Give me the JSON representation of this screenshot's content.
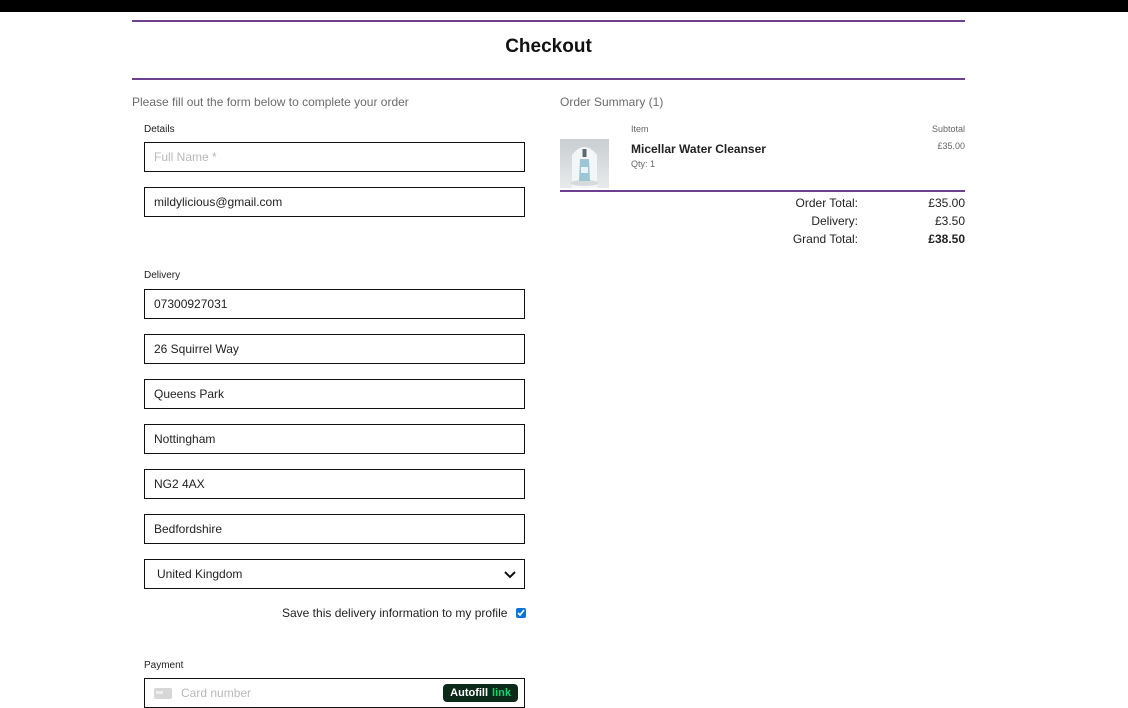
{
  "page": {
    "title": "Checkout",
    "intro": "Please fill out the form below to complete your order"
  },
  "details": {
    "label": "Details",
    "full_name": {
      "value": "",
      "placeholder": "Full Name *"
    },
    "email": {
      "value": "mildylicious@gmail.com"
    }
  },
  "delivery": {
    "label": "Delivery",
    "phone": "07300927031",
    "street_address_1": "26 Squirrel Way",
    "street_address_2": "Queens Park",
    "town_or_city": "Nottingham",
    "postcode": "NG2 4AX",
    "county": "Bedfordshire",
    "country": "United Kingdom",
    "save_info_label": "Save this delivery information to my profile",
    "save_info_checked": true
  },
  "payment": {
    "label": "Payment",
    "card_placeholder": "Card number",
    "autofill_label": "Autofill",
    "autofill_link_label": "link"
  },
  "summary": {
    "title": "Order Summary (1)",
    "col_item": "Item",
    "col_subtotal": "Subtotal",
    "items": [
      {
        "name": "Micellar Water Cleanser",
        "qty": "Qty: 1",
        "subtotal": "£35.00"
      }
    ],
    "order_total_label": "Order Total:",
    "order_total": "£35.00",
    "delivery_label": "Delivery:",
    "delivery": "£3.50",
    "grand_total_label": "Grand Total:",
    "grand_total": "£38.50"
  },
  "colors": {
    "accent_purple": "#6f3f8f",
    "topbar": "#000000",
    "autofill_bg": "#0b2a1a",
    "autofill_link": "#00d66f"
  }
}
